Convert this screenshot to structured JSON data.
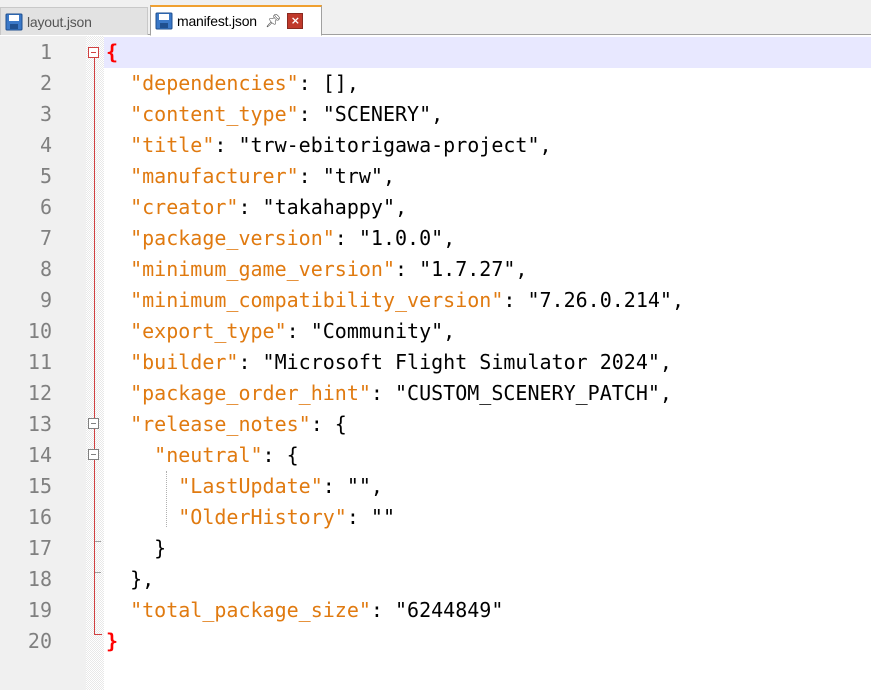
{
  "tabs": [
    {
      "label": "layout.json",
      "active": false
    },
    {
      "label": "manifest.json",
      "active": true
    }
  ],
  "colors": {
    "key": "#e07a10",
    "value": "#000000",
    "brace_highlight": "#ff0000",
    "current_line": "#e8e8ff"
  },
  "line_numbers": [
    "1",
    "2",
    "3",
    "4",
    "5",
    "6",
    "7",
    "8",
    "9",
    "10",
    "11",
    "12",
    "13",
    "14",
    "15",
    "16",
    "17",
    "18",
    "19",
    "20"
  ],
  "lines": [
    {
      "indent": "",
      "key": "",
      "rest": "{",
      "highlight": true
    },
    {
      "indent": "  ",
      "key": "\"dependencies\"",
      "rest": ": [],"
    },
    {
      "indent": "  ",
      "key": "\"content_type\"",
      "rest": ": \"SCENERY\","
    },
    {
      "indent": "  ",
      "key": "\"title\"",
      "rest": ": \"trw-ebitorigawa-project\","
    },
    {
      "indent": "  ",
      "key": "\"manufacturer\"",
      "rest": ": \"trw\","
    },
    {
      "indent": "  ",
      "key": "\"creator\"",
      "rest": ": \"takahappy\","
    },
    {
      "indent": "  ",
      "key": "\"package_version\"",
      "rest": ": \"1.0.0\","
    },
    {
      "indent": "  ",
      "key": "\"minimum_game_version\"",
      "rest": ": \"1.7.27\","
    },
    {
      "indent": "  ",
      "key": "\"minimum_compatibility_version\"",
      "rest": ": \"7.26.0.214\","
    },
    {
      "indent": "  ",
      "key": "\"export_type\"",
      "rest": ": \"Community\","
    },
    {
      "indent": "  ",
      "key": "\"builder\"",
      "rest": ": \"Microsoft Flight Simulator 2024\","
    },
    {
      "indent": "  ",
      "key": "\"package_order_hint\"",
      "rest": ": \"CUSTOM_SCENERY_PATCH\","
    },
    {
      "indent": "  ",
      "key": "\"release_notes\"",
      "rest": ": {"
    },
    {
      "indent": "    ",
      "key": "\"neutral\"",
      "rest": ": {"
    },
    {
      "indent": "      ",
      "key": "\"LastUpdate\"",
      "rest": ": \"\","
    },
    {
      "indent": "      ",
      "key": "\"OlderHistory\"",
      "rest": ": \"\""
    },
    {
      "indent": "    ",
      "key": "",
      "rest": "}"
    },
    {
      "indent": "  ",
      "key": "",
      "rest": "},"
    },
    {
      "indent": "  ",
      "key": "\"total_package_size\"",
      "rest": ": \"6244849\""
    },
    {
      "indent": "",
      "key": "",
      "rest": "}",
      "highlight": true
    }
  ]
}
